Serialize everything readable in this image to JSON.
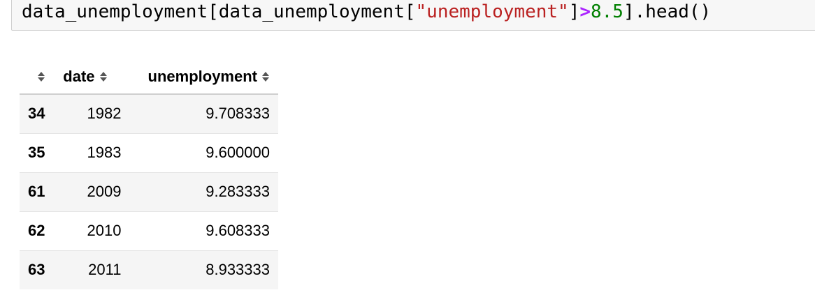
{
  "code_cell": {
    "tokens": {
      "t1": "data_unemployment[data_unemployment[",
      "t2": "\"unemployment\"",
      "t3": "]",
      "t4": ">",
      "t5": "8.5",
      "t6": "].head()"
    }
  },
  "table": {
    "columns": {
      "index": "",
      "date": "date",
      "unemployment": "unemployment"
    },
    "rows": [
      {
        "index": "34",
        "date": "1982",
        "unemployment": "9.708333"
      },
      {
        "index": "35",
        "date": "1983",
        "unemployment": "9.600000"
      },
      {
        "index": "61",
        "date": "2009",
        "unemployment": "9.283333"
      },
      {
        "index": "62",
        "date": "2010",
        "unemployment": "9.608333"
      },
      {
        "index": "63",
        "date": "2011",
        "unemployment": "8.933333"
      }
    ]
  },
  "icons": {
    "sort": "sort-updown-icon"
  },
  "colors": {
    "string": "#ba2121",
    "operator": "#aa22ff",
    "number": "#008000"
  }
}
